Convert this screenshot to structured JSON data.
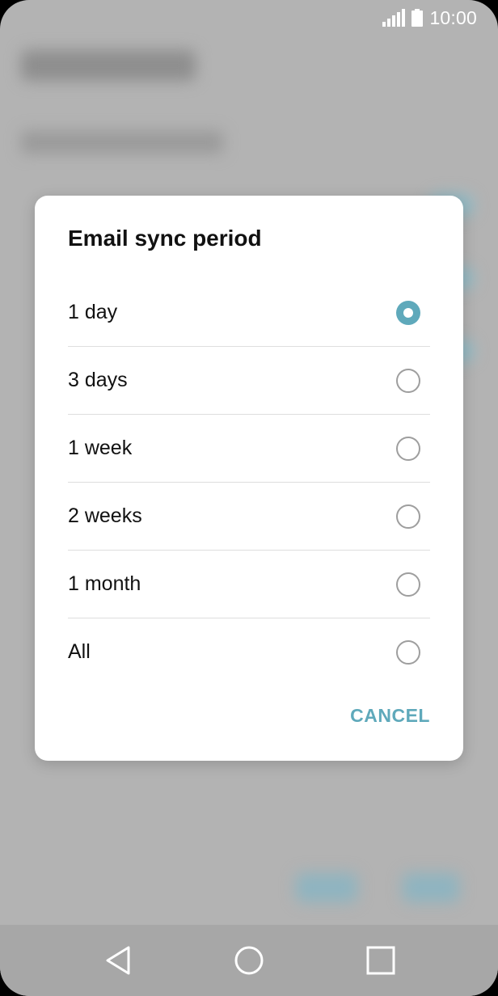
{
  "status_bar": {
    "time": "10:00",
    "icons": [
      "signal-icon",
      "battery-icon"
    ]
  },
  "dialog": {
    "title": "Email sync period",
    "options": [
      {
        "label": "1 day",
        "selected": true
      },
      {
        "label": "3 days",
        "selected": false
      },
      {
        "label": "1 week",
        "selected": false
      },
      {
        "label": "2 weeks",
        "selected": false
      },
      {
        "label": "1 month",
        "selected": false
      },
      {
        "label": "All",
        "selected": false
      }
    ],
    "cancel_label": "CANCEL"
  },
  "nav_bar": {
    "icons": [
      "back-icon",
      "home-icon",
      "recents-icon"
    ]
  },
  "colors": {
    "accent": "#5fa9bb",
    "scrim": "#b3b3b3",
    "dialog_background": "#ffffff"
  }
}
